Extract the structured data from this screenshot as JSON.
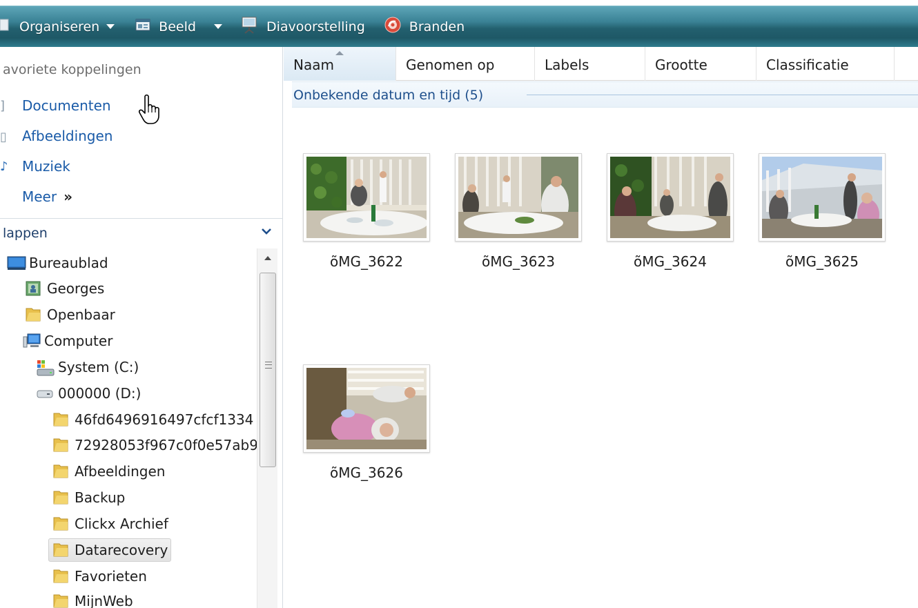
{
  "toolbar": {
    "organize_label": "Organiseren",
    "view_label": "Beeld",
    "slideshow_label": "Diavoorstelling",
    "burn_label": "Branden"
  },
  "favorites": {
    "title": "avoriete koppelingen",
    "items": [
      "Documenten",
      "Afbeeldingen",
      "Muziek",
      "Meer"
    ],
    "more_arrow": "»"
  },
  "folders": {
    "title": "lappen",
    "tree": [
      "Bureaublad",
      "Georges",
      "Openbaar",
      "Computer",
      "System (C:)",
      "000000 (D:)",
      "46fd6496916497cfcf1334",
      "72928053f967c0f0e57ab9",
      "Afbeeldingen",
      "Backup",
      "Clickx Archief",
      "Datarecovery",
      "Favorieten",
      "MijnWeb"
    ]
  },
  "columns": [
    "Naam",
    "Genomen op",
    "Labels",
    "Grootte",
    "Classificatie"
  ],
  "group": {
    "label": "Onbekende datum en tijd (5)"
  },
  "files": [
    "õMG_3622",
    "õMG_3623",
    "õMG_3624",
    "õMG_3625",
    "õMG_3626"
  ],
  "colors": {
    "toolbar": "#2f7c8e",
    "link": "#1a5ba8",
    "group_text": "#1e4f8c",
    "folder": "#e8c04c"
  }
}
